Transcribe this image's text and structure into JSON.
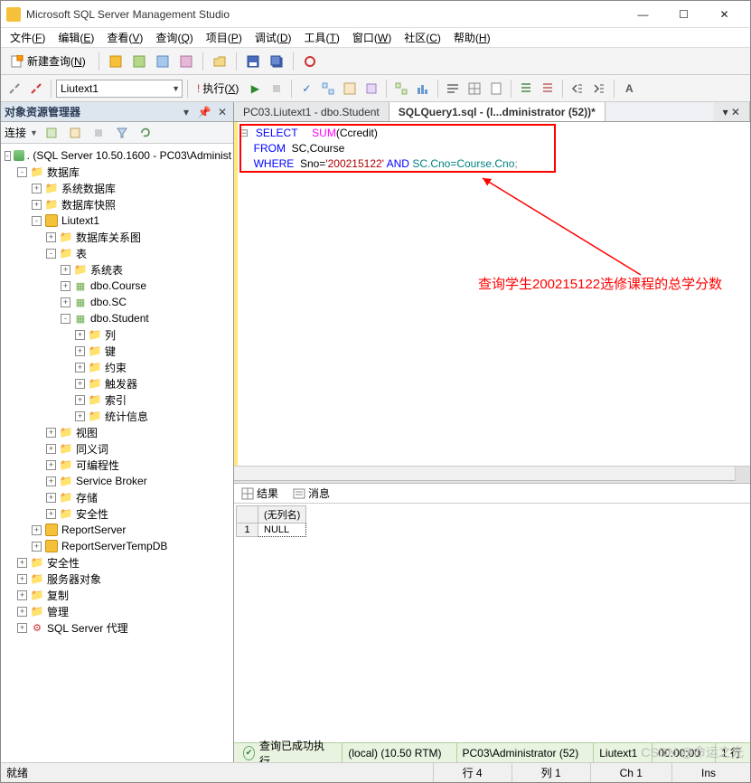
{
  "title": "Microsoft SQL Server Management Studio",
  "menu": {
    "file": "文件",
    "f": "F",
    "edit": "编辑",
    "e": "E",
    "view": "查看",
    "v": "V",
    "query": "查询",
    "q": "Q",
    "project": "项目",
    "p": "P",
    "debug": "调试",
    "d": "D",
    "tools": "工具",
    "t": "T",
    "window": "窗口",
    "w": "W",
    "community": "社区",
    "c": "C",
    "help": "帮助",
    "h": "H"
  },
  "toolbar": {
    "newquery": "新建查询",
    "n": "N",
    "exec": "执行",
    "x": "X"
  },
  "dbselector": "Liutext1",
  "object_explorer": {
    "title": "对象资源管理器",
    "connect": "连接",
    "root": ". (SQL Server 10.50.1600 - PC03\\Administ",
    "db": "数据库",
    "sysdb": "系统数据库",
    "dbsnap": "数据库快照",
    "liutext": "Liutext1",
    "dbrel": "数据库关系图",
    "tables": "表",
    "systables": "系统表",
    "course": "dbo.Course",
    "sc": "dbo.SC",
    "student": "dbo.Student",
    "col": "列",
    "key": "键",
    "constraint": "约束",
    "trigger": "触发器",
    "index": "索引",
    "stats": "统计信息",
    "views": "视图",
    "synonyms": "同义词",
    "programmability": "可编程性",
    "sb": "Service Broker",
    "storage": "存储",
    "security": "安全性",
    "rs": "ReportServer",
    "rstemp": "ReportServerTempDB",
    "rootsec": "安全性",
    "serverobj": "服务器对象",
    "replication": "复制",
    "management": "管理",
    "agent": "SQL Server 代理"
  },
  "tabs": {
    "t1": "PC03.Liutext1 - dbo.Student",
    "t2": "SQLQuery1.sql - (l...dministrator (52))*"
  },
  "sql": {
    "select": "SELECT",
    "sum": "SUM",
    "sumarg": "(Ccredit)",
    "from": "FROM",
    "fromarg": "  SC,Course",
    "where": "WHERE",
    "sno": "  Sno=",
    "snoval": "'200215122'",
    "and": " AND ",
    "cond": "SC.Cno=Course.Cno",
    ";": ";"
  },
  "annot": "查询学生200215122选修课程的总学分数",
  "results": {
    "tab1": "结果",
    "tab2": "消息",
    "colhead": "(无列名)",
    "cell": "NULL",
    "row": "1"
  },
  "status_green": {
    "msg": "查询已成功执行。",
    "server": "(local) (10.50 RTM)",
    "user": "PC03\\Administrator (52)",
    "db": "Liutext1",
    "time": "00:00:00",
    "rows": "1 行"
  },
  "status_bottom": {
    "ready": "就绪",
    "line": "行 4",
    "col": "列 1",
    "ch": "Ch 1",
    "ins": "Ins"
  },
  "watermark": "CSDN @命运之光"
}
